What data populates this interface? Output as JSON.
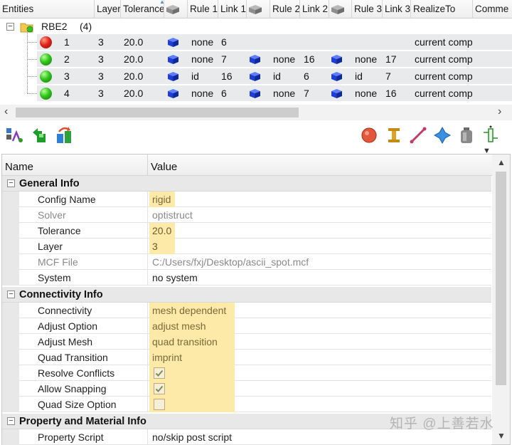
{
  "entities_table": {
    "headers": {
      "entities": "Entities",
      "layer": "Layer",
      "tolerance": "Tolerance",
      "rule1": "Rule 1",
      "link1": "Link 1",
      "rule2": "Rule 2",
      "link2": "Link 2",
      "rule3": "Rule 3",
      "link3": "Link 3",
      "realize_to": "RealizeTo",
      "comment": "Comme"
    },
    "group": {
      "name": "RBE2",
      "count": "(4)"
    },
    "rows": [
      {
        "id": "1",
        "status": "red",
        "layer": "3",
        "tolerance": "20.0",
        "rule1": "none",
        "link1": "6",
        "rule2": "",
        "link2": "",
        "rule3": "",
        "link3": "",
        "realize_to": "current comp"
      },
      {
        "id": "2",
        "status": "green",
        "layer": "3",
        "tolerance": "20.0",
        "rule1": "none",
        "link1": "7",
        "rule2": "none",
        "link2": "16",
        "rule3": "none",
        "link3": "17",
        "realize_to": "current comp"
      },
      {
        "id": "3",
        "status": "green",
        "layer": "3",
        "tolerance": "20.0",
        "rule1": "id",
        "link1": "16",
        "rule2": "id",
        "link2": "6",
        "rule3": "id",
        "link3": "7",
        "realize_to": "current comp"
      },
      {
        "id": "4",
        "status": "green",
        "layer": "3",
        "tolerance": "20.0",
        "rule1": "none",
        "link1": "6",
        "rule2": "none",
        "link2": "7",
        "rule3": "none",
        "link3": "16",
        "realize_to": "current comp"
      }
    ]
  },
  "toolbar": {
    "left_icons": [
      "realize-icon",
      "unrealize-icon",
      "reset-icon"
    ],
    "right_icons": [
      "spot-icon",
      "bolt-icon",
      "seam-icon",
      "area-icon",
      "apply-mass-icon",
      "connector-options-icon"
    ]
  },
  "property_grid": {
    "headers": {
      "name": "Name",
      "value": "Value"
    },
    "sections": {
      "general": {
        "title": "General Info",
        "config_name": {
          "label": "Config Name",
          "value": "rigid"
        },
        "solver": {
          "label": "Solver",
          "value": "optistruct"
        },
        "tolerance": {
          "label": "Tolerance",
          "value": "20.0"
        },
        "layer": {
          "label": "Layer",
          "value": "3"
        },
        "mcf_file": {
          "label": "MCF File",
          "value": "C:/Users/fxj/Desktop/ascii_spot.mcf"
        },
        "system": {
          "label": "System",
          "value": "no system"
        }
      },
      "connectivity": {
        "title": "Connectivity Info",
        "connectivity": {
          "label": "Connectivity",
          "value": "mesh dependent"
        },
        "adjust_option": {
          "label": "Adjust Option",
          "value": "adjust mesh"
        },
        "adjust_mesh": {
          "label": "Adjust Mesh",
          "value": "quad transition"
        },
        "quad_transition": {
          "label": "Quad Transition",
          "value": "imprint"
        },
        "resolve_conflicts": {
          "label": "Resolve Conflicts",
          "checked": true
        },
        "allow_snapping": {
          "label": "Allow Snapping",
          "checked": true
        },
        "quad_size_option": {
          "label": "Quad Size Option",
          "checked": false
        }
      },
      "property": {
        "title": "Property and Material Info",
        "property_script": {
          "label": "Property Script",
          "value": "no/skip post script"
        }
      }
    }
  },
  "watermark": "知乎 @上善若水",
  "colors": {
    "highlight": "#fde9a8",
    "row_bg": "#e9eaec",
    "category_bg": "#e8e8e8",
    "cube_blue": "#1f3fd0"
  }
}
